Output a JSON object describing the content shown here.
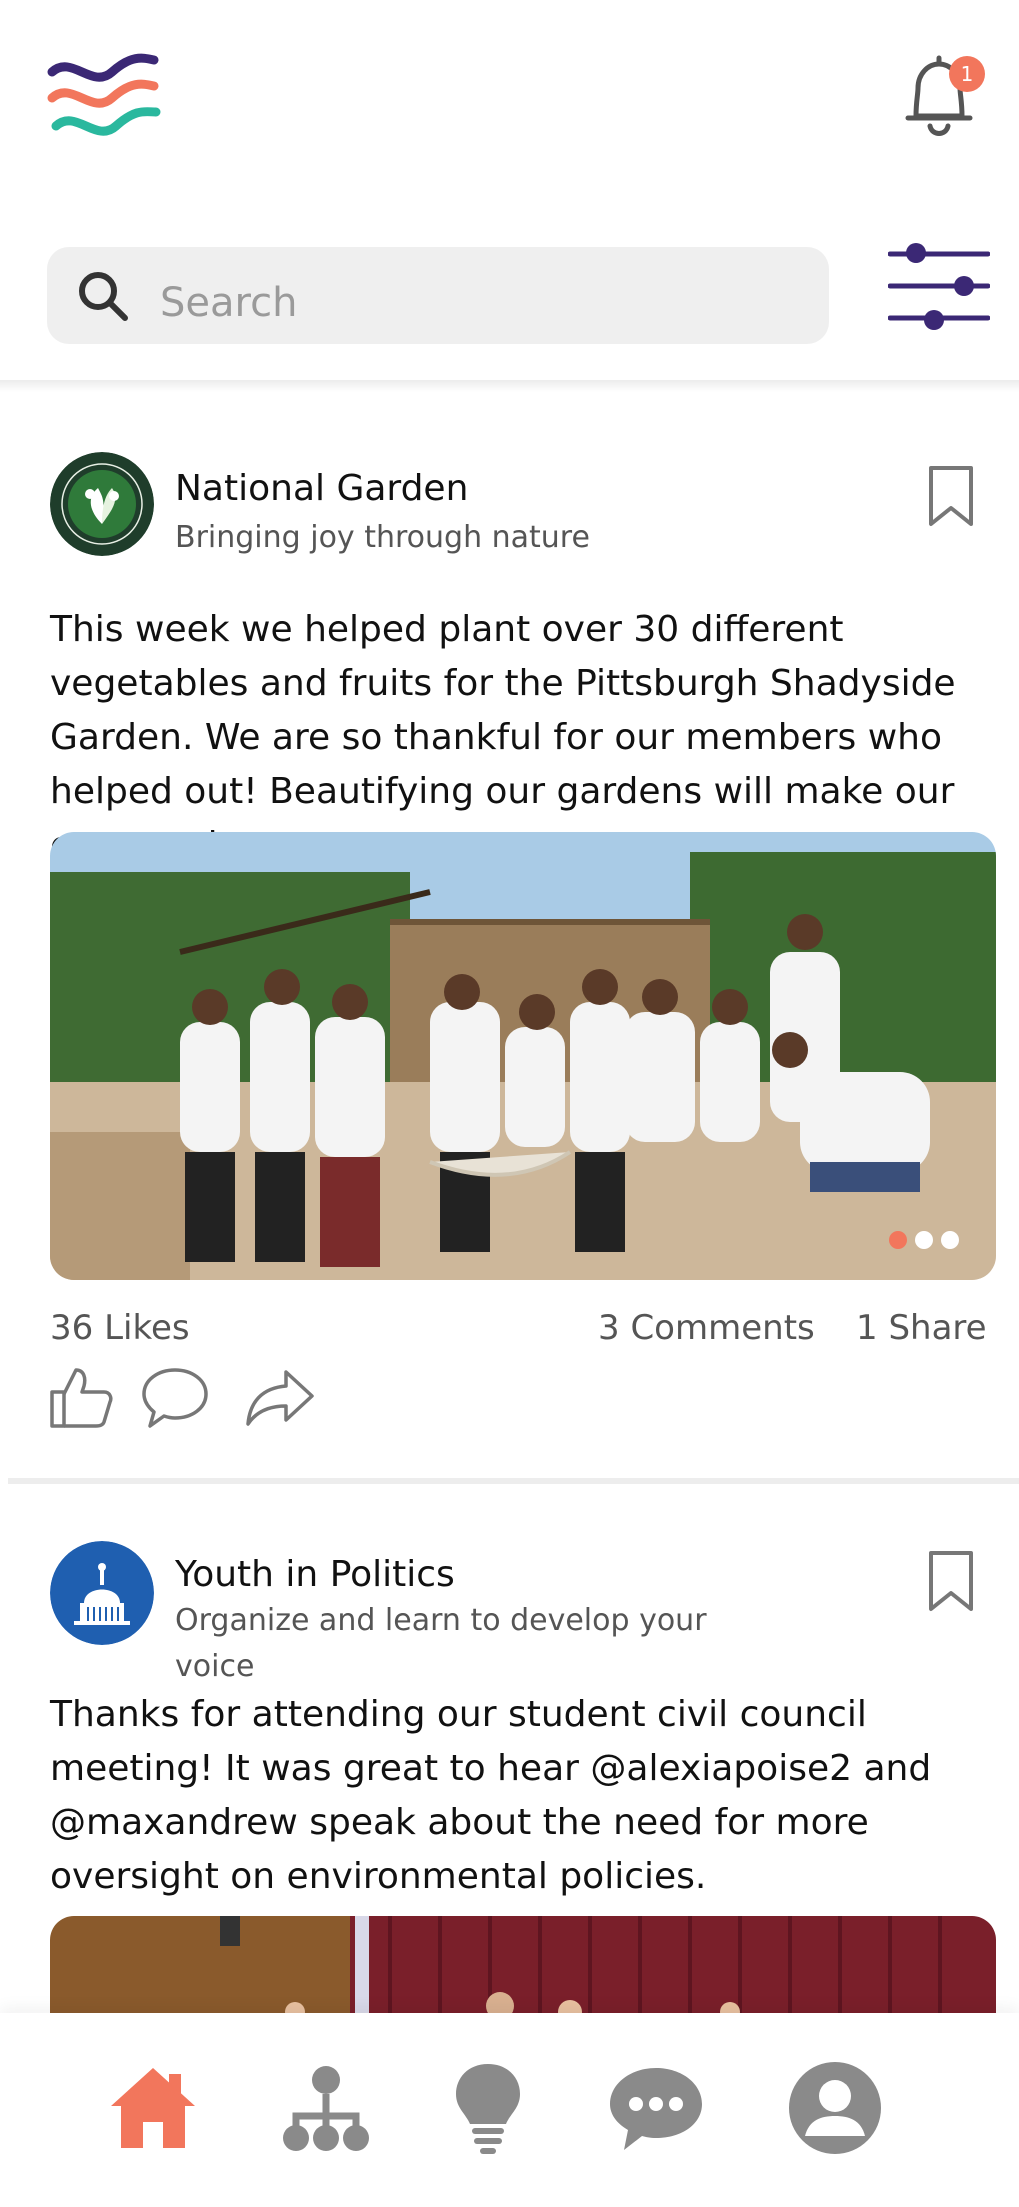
{
  "header": {
    "notification_count": "1",
    "search_placeholder": "Search",
    "colors": {
      "brand_purple": "#3b2875",
      "brand_orange": "#f2765c",
      "brand_teal": "#2ab89e"
    }
  },
  "icons": {
    "logo": "wave-logo",
    "bell": "bell-icon",
    "search": "search-icon",
    "filter": "sliders-icon",
    "bookmark": "bookmark-icon",
    "like": "thumbs-up-icon",
    "comment": "comment-icon",
    "share": "share-arrow-icon"
  },
  "posts": [
    {
      "org_name": "National Garden",
      "org_tagline": "Bringing joy through nature",
      "text": "This week we helped plant over 30 different vegetables and fruits for the Pittsburgh Shadyside Garden. We are so thankful for our members who helped out! Beautifying our gardens will make our community stronger.",
      "likes": "36 Likes",
      "comments": "3 Comments",
      "shares": "1 Share",
      "image_dots": 3,
      "active_dot": 1
    },
    {
      "org_name": "Youth in Politics",
      "org_tagline": "Organize and learn to develop your voice",
      "text": "Thanks for attending our student civil council meeting! It was great to hear @alexiapoise2 and @maxandrew speak about the need for more oversight on environmental policies."
    }
  ],
  "nav": {
    "items": [
      "home-icon",
      "org-chart-icon",
      "lightbulb-icon",
      "chat-icon",
      "profile-icon"
    ],
    "active_item": "home-icon",
    "active_color": "#f2765c",
    "inactive_color": "#8a8a8a"
  }
}
